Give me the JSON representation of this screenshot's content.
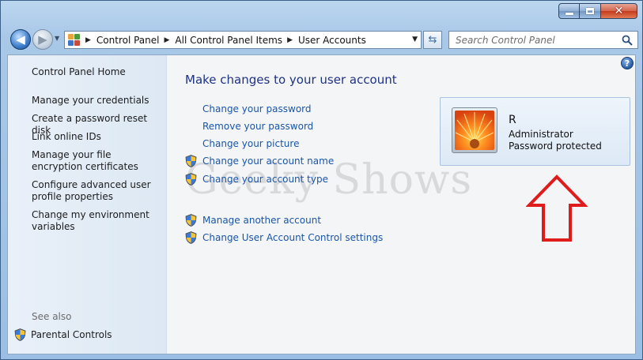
{
  "window": {
    "caption": {
      "minimize": "minimize",
      "maximize": "maximize",
      "close": "close"
    }
  },
  "nav": {
    "breadcrumbs": [
      "Control Panel",
      "All Control Panel Items",
      "User Accounts"
    ],
    "search_placeholder": "Search Control Panel"
  },
  "sidebar": {
    "items": [
      "Control Panel Home",
      "Manage your credentials",
      "Create a password reset disk",
      "Link online IDs",
      "Manage your file encryption certificates",
      "Configure advanced user profile properties",
      "Change my environment variables"
    ],
    "see_also_label": "See also",
    "see_also_items": [
      "Parental Controls"
    ]
  },
  "main": {
    "title": "Make changes to your user account",
    "tasks": [
      {
        "label": "Change your password",
        "shield": false
      },
      {
        "label": "Remove your password",
        "shield": false
      },
      {
        "label": "Change your picture",
        "shield": false
      },
      {
        "label": "Change your account name",
        "shield": true
      },
      {
        "label": "Change your account type",
        "shield": true
      },
      {
        "label": "Manage another account",
        "shield": true
      },
      {
        "label": "Change User Account Control settings",
        "shield": true
      }
    ]
  },
  "account": {
    "name": "R",
    "type": "Administrator",
    "status": "Password protected"
  },
  "watermark": "Geeky Shows",
  "colors": {
    "link": "#1a55a8",
    "title": "#1e3287",
    "arrow": "#e01b1b"
  },
  "icons": {
    "back": "back-arrow-icon",
    "forward": "forward-arrow-icon",
    "shield": "uac-shield-icon",
    "search": "search-icon",
    "help": "help-icon"
  }
}
